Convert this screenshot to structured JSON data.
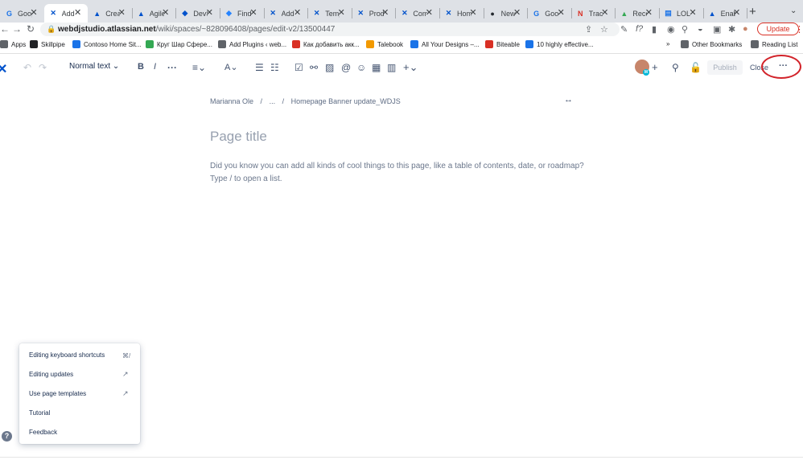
{
  "browser": {
    "tabs": [
      {
        "title": "Goog",
        "icon": "google-docs-icon",
        "color": "#1a73e8"
      },
      {
        "title": "Add",
        "icon": "confluence-icon",
        "color": "#0052CC",
        "active": true
      },
      {
        "title": "Crea",
        "icon": "atlassian-icon",
        "color": "#0052CC"
      },
      {
        "title": "Agile",
        "icon": "atlassian-icon",
        "color": "#0052CC"
      },
      {
        "title": "DevS",
        "icon": "diamond-icon",
        "color": "#0052CC"
      },
      {
        "title": "Find",
        "icon": "diamond-icon",
        "color": "#2684FF"
      },
      {
        "title": "Add",
        "icon": "confluence-icon",
        "color": "#0052CC"
      },
      {
        "title": "Temp",
        "icon": "confluence-icon",
        "color": "#0052CC"
      },
      {
        "title": "Prod",
        "icon": "confluence-icon",
        "color": "#0052CC"
      },
      {
        "title": "Com",
        "icon": "confluence-icon",
        "color": "#0052CC"
      },
      {
        "title": "Hom",
        "icon": "confluence-icon",
        "color": "#0052CC"
      },
      {
        "title": "New",
        "icon": "github-icon",
        "color": "#24292e"
      },
      {
        "title": "Goog",
        "icon": "google-docs-icon",
        "color": "#1a73e8"
      },
      {
        "title": "Track",
        "icon": "nn-icon",
        "color": "#d93025"
      },
      {
        "title": "Rece",
        "icon": "google-drive-icon",
        "color": "#34a853"
      },
      {
        "title": "LOL",
        "icon": "document-icon",
        "color": "#1a73e8"
      },
      {
        "title": "Enab",
        "icon": "atlassian-icon",
        "color": "#0052CC"
      }
    ],
    "new_tab": "+",
    "tab_close": "✕",
    "url_host": "webdjstudio.atlassian.net",
    "url_path": "/wiki/spaces/~828096408/pages/edit-v2/13500447",
    "update_label": "Update",
    "bookmarks": [
      {
        "label": "Apps",
        "color": "#5f6368"
      },
      {
        "label": "Skillpipe",
        "color": "#202124"
      },
      {
        "label": "Contoso Home Sit...",
        "color": "#1a73e8"
      },
      {
        "label": "Круг Шар Сфере...",
        "color": "#34a853"
      },
      {
        "label": "Add Plugins ‹ web...",
        "color": "#5f6368"
      },
      {
        "label": "Как добавить акк...",
        "color": "#d93025"
      },
      {
        "label": "Talebook",
        "color": "#f29900"
      },
      {
        "label": "All Your Designs –...",
        "color": "#1a73e8"
      },
      {
        "label": "Biteable",
        "color": "#d93025"
      },
      {
        "label": "10 highly effective...",
        "color": "#1a73e8"
      }
    ],
    "bookmarks_overflow": "»",
    "other_bookmarks": "Other Bookmarks",
    "reading_list": "Reading List"
  },
  "editor": {
    "text_style": "Normal text",
    "publish_label": "Publish",
    "close_label": "Close",
    "more_label": "···",
    "avatar_badge": "M"
  },
  "page": {
    "breadcrumb": [
      "Marianna Ole",
      "/",
      "...",
      "/",
      "Homepage Banner update_WDJS"
    ],
    "title_placeholder": "Page title",
    "body_line1": "Did you know you can add all kinds of cool things to this page, like a table of contents, date, or roadmap?",
    "body_line2": "Type / to open a list."
  },
  "help_menu": {
    "items": [
      {
        "label": "Editing keyboard shortcuts",
        "right": "⌘/"
      },
      {
        "label": "Editing updates",
        "right": "↗"
      },
      {
        "label": "Use page templates",
        "right": "↗"
      },
      {
        "label": "Tutorial",
        "right": ""
      },
      {
        "label": "Feedback",
        "right": ""
      }
    ],
    "help_icon": "?"
  }
}
